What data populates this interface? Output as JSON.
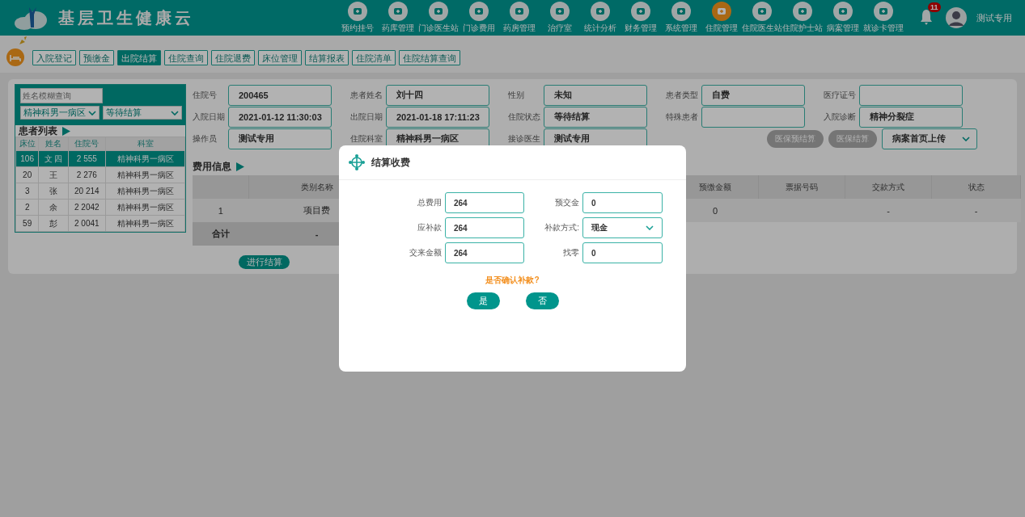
{
  "header": {
    "title": "基层卫生健康云",
    "modules": [
      {
        "label": "预约挂号",
        "selected": false
      },
      {
        "label": "药库管理",
        "selected": false
      },
      {
        "label": "门诊医生站",
        "selected": false
      },
      {
        "label": "门诊费用",
        "selected": false
      },
      {
        "label": "药房管理",
        "selected": false
      },
      {
        "label": "治疗室",
        "selected": false
      },
      {
        "label": "统计分析",
        "selected": false
      },
      {
        "label": "财务管理",
        "selected": false
      },
      {
        "label": "系统管理",
        "selected": false
      },
      {
        "label": "住院管理",
        "selected": true
      },
      {
        "label": "住院医生站",
        "selected": false
      },
      {
        "label": "住院护士站",
        "selected": false
      },
      {
        "label": "病案管理",
        "selected": false
      },
      {
        "label": "就诊卡管理",
        "selected": false
      }
    ],
    "notification_count": "11",
    "user": "测试专用"
  },
  "tabs": [
    {
      "label": "入院登记",
      "selected": false
    },
    {
      "label": "预缴金",
      "selected": false
    },
    {
      "label": "出院结算",
      "selected": true
    },
    {
      "label": "住院查询",
      "selected": false
    },
    {
      "label": "住院退费",
      "selected": false
    },
    {
      "label": "床位管理",
      "selected": false
    },
    {
      "label": "结算报表",
      "selected": false
    },
    {
      "label": "住院清单",
      "selected": false
    },
    {
      "label": "住院结算查询",
      "selected": false
    }
  ],
  "patient_panel": {
    "search": {
      "placeholder": "姓名模糊查询"
    },
    "ward_select": "精神科男一病区",
    "status_select": "等待结算",
    "title": "患者列表",
    "columns": [
      "床位",
      "姓名",
      "住院号",
      "科室"
    ],
    "rows": [
      {
        "cells": [
          "106",
          "文 四",
          "2 555",
          "精神科男一病区"
        ],
        "selected": true
      },
      {
        "cells": [
          "20",
          "王",
          "2 276",
          "精神科男一病区"
        ],
        "selected": false
      },
      {
        "cells": [
          "3",
          "张",
          "20 214",
          "精神科男一病区"
        ],
        "selected": false
      },
      {
        "cells": [
          "2",
          "余",
          "2 2042",
          "精神科男一病区"
        ],
        "selected": false
      },
      {
        "cells": [
          "59",
          "彭",
          "2 0041",
          "精神科男一病区"
        ],
        "selected": false
      }
    ]
  },
  "form": {
    "rows": [
      [
        {
          "label": "住院号",
          "value": "200465"
        },
        {
          "label": "患者姓名",
          "value": "刘十四"
        },
        {
          "label": "性别",
          "value": "未知"
        },
        {
          "label": "患者类型",
          "value": "自费"
        },
        {
          "label": "医疗证号"
        }
      ],
      [
        {
          "label": "入院日期",
          "value": "2021-01-12 11:30:03"
        },
        {
          "label": "出院日期",
          "value": "2021-01-18 17:11:23"
        },
        {
          "label": "住院状态",
          "value": "等待结算"
        },
        {
          "label": "特殊患者"
        },
        {
          "label": "入院诊断",
          "value": "精神分裂症"
        }
      ],
      [
        {
          "label": "操作员",
          "value": "测试专用"
        },
        {
          "label": "住院科室",
          "value": "精神科男一病区"
        },
        {
          "label": "接诊医生",
          "value": "测试专用"
        }
      ]
    ],
    "buttons": [
      {
        "label": "医保预结算",
        "disabled": true
      },
      {
        "label": "医保结算",
        "disabled": true
      }
    ],
    "upload_select": "病案首页上传"
  },
  "fees": {
    "title": "费用信息",
    "columns": [
      {},
      {
        "label": "类别名称"
      },
      {},
      {},
      {},
      {
        "label": "预缴金额"
      },
      {
        "label": "票据号码"
      },
      {
        "label": "交款方式"
      },
      {
        "label": "状态"
      }
    ],
    "rows": [
      {
        "kind": "item",
        "cells": [
          "1",
          "项目费",
          null,
          null,
          null,
          "0",
          null,
          "-",
          "-"
        ]
      },
      {
        "kind": "total",
        "cells": [
          "合计",
          "-"
        ]
      }
    ]
  },
  "settle_button": "进行结算",
  "dialog": {
    "title": "结算收费",
    "fields": [
      {
        "label": "总费用",
        "value": "264",
        "kind": "input"
      },
      {
        "label": "预交金",
        "value": "0",
        "kind": "input"
      },
      {
        "label": "应补款",
        "value": "264",
        "kind": "input"
      },
      {
        "label": "补款方式:",
        "value": "现金",
        "kind": "select"
      },
      {
        "label": "交来金额",
        "value": "264",
        "kind": "input"
      },
      {
        "label": "找零",
        "value": "0",
        "kind": "input"
      }
    ],
    "prompt": "是否确认补款?",
    "buttons": [
      "是",
      "否"
    ]
  }
}
